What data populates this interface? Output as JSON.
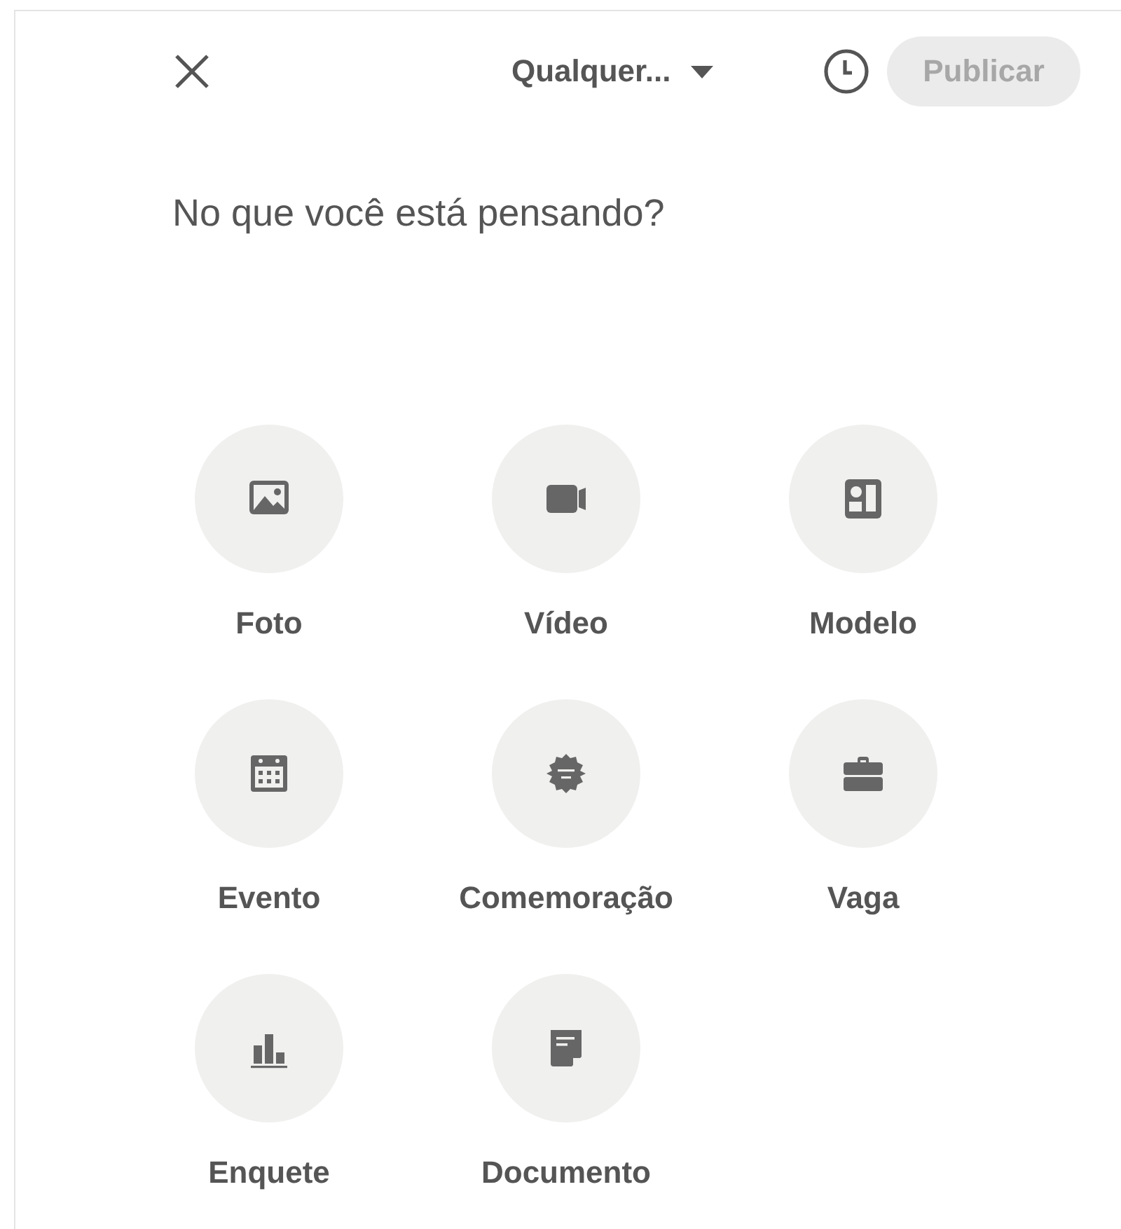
{
  "header": {
    "audience": {
      "label": "Qualquer..."
    },
    "publish": {
      "label": "Publicar",
      "disabled": true
    }
  },
  "composer": {
    "placeholder": "No que você está pensando?"
  },
  "actions": [
    {
      "label": "Foto"
    },
    {
      "label": "Vídeo"
    },
    {
      "label": "Modelo"
    },
    {
      "label": "Evento"
    },
    {
      "label": "Comemoração"
    },
    {
      "label": "Vaga"
    },
    {
      "label": "Enquete"
    },
    {
      "label": "Documento"
    }
  ]
}
